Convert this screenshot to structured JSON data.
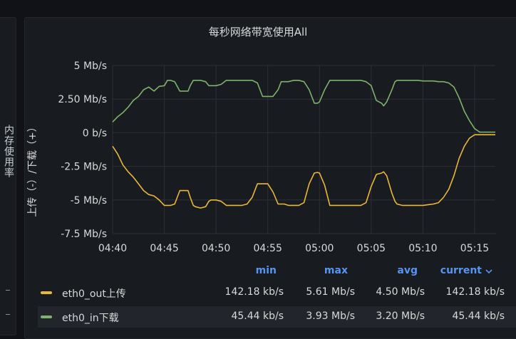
{
  "left_panel": {
    "vertical_text": "内存使用率"
  },
  "colors": {
    "in": "#7eb26d",
    "out": "#eab839",
    "grid": "#2c2f35",
    "axis_text": "#d8d9da",
    "legend_header": "#5794f2"
  },
  "legend": {
    "headers": [
      "min",
      "max",
      "avg",
      "current"
    ],
    "current_sort_icon": "chevron-down-icon",
    "rows": [
      {
        "name": "eth0_out上传",
        "color": "#eab839",
        "min": "142.18 kb/s",
        "max": "5.61 Mb/s",
        "avg": "4.50 Mb/s",
        "current": "142.18 kb/s"
      },
      {
        "name": "eth0_in下载",
        "color": "#7eb26d",
        "min": "45.44 kb/s",
        "max": "3.93 Mb/s",
        "avg": "3.20 Mb/s",
        "current": "45.44 kb/s"
      }
    ]
  },
  "chart_data": {
    "type": "line",
    "title": "每秒网络带宽使用All",
    "ylabel": "上传（-）/下载（+）",
    "xlabel": "",
    "ylim": [
      -7.5,
      5
    ],
    "yticks": [
      5,
      2.5,
      0,
      -2.5,
      -5,
      -7.5
    ],
    "ytick_labels": [
      "5 Mb/s",
      "2.50 Mb/s",
      "0 b/s",
      "-2.5 Mb/s",
      "-5 Mb/s",
      "-7.5 Mb/s"
    ],
    "xlim": [
      0,
      37
    ],
    "xticks": [
      0,
      5,
      10,
      15,
      20,
      25,
      30,
      35
    ],
    "xtick_labels": [
      "04:40",
      "04:45",
      "04:50",
      "04:55",
      "05:00",
      "05:05",
      "05:10",
      "05:15"
    ],
    "x_unit": "minutes after 04:40",
    "grid": true,
    "series": [
      {
        "name": "eth0_in下载",
        "color": "#7eb26d",
        "x": [
          0,
          0.5,
          1,
          1.5,
          2,
          2.5,
          3,
          3.5,
          4,
          4.5,
          5,
          5.3,
          5.6,
          6,
          6.5,
          7,
          7.3,
          7.5,
          7.8,
          8,
          8.5,
          9,
          9.3,
          9.5,
          9.8,
          10,
          10.5,
          11,
          11.5,
          12,
          12.5,
          13,
          13.5,
          14,
          14.5,
          15,
          15.5,
          16,
          16.3,
          16.6,
          17,
          17.5,
          18,
          18.5,
          19,
          19.5,
          19.8,
          20,
          20.5,
          21,
          21.5,
          22,
          22.5,
          23,
          23.5,
          24,
          24.5,
          25,
          25.5,
          26,
          26.2,
          26.5,
          27,
          27.3,
          27.5,
          28,
          28.5,
          29,
          29.5,
          30,
          30.5,
          31,
          31.5,
          32,
          32.5,
          33,
          33.5,
          34,
          34.5,
          35,
          35.5,
          36,
          36.5,
          37
        ],
        "y": [
          0.8,
          1.2,
          1.5,
          1.9,
          2.4,
          2.7,
          3.2,
          3.4,
          3.1,
          3.45,
          3.5,
          3.9,
          3.9,
          3.8,
          3.1,
          3.1,
          3.1,
          3.5,
          3.9,
          3.9,
          3.9,
          3.8,
          3.5,
          3.5,
          3.5,
          3.5,
          3.6,
          3.9,
          3.9,
          3.9,
          3.9,
          3.9,
          3.9,
          3.7,
          2.7,
          2.7,
          2.7,
          3.2,
          3.8,
          3.8,
          3.8,
          3.9,
          3.9,
          3.8,
          3.2,
          2.2,
          2.2,
          2.3,
          3.2,
          3.9,
          3.9,
          3.9,
          3.9,
          3.9,
          3.9,
          3.9,
          3.8,
          3.5,
          2.4,
          2.2,
          2.0,
          2.3,
          3.2,
          3.8,
          3.9,
          3.9,
          3.9,
          3.9,
          3.9,
          3.85,
          3.85,
          3.85,
          3.8,
          3.8,
          3.7,
          3.4,
          2.6,
          1.6,
          0.9,
          0.3,
          0.05,
          0.05,
          0.05,
          0.05
        ]
      },
      {
        "name": "eth0_out上传",
        "color": "#eab839",
        "x": [
          0,
          0.5,
          1,
          1.5,
          2,
          2.5,
          3,
          3.5,
          4,
          4.5,
          5,
          5.3,
          5.6,
          6,
          6.5,
          7,
          7.3,
          7.5,
          7.8,
          8,
          8.5,
          9,
          9.3,
          9.5,
          9.8,
          10,
          10.5,
          11,
          11.5,
          12,
          12.5,
          13,
          13.5,
          14,
          14.5,
          15,
          15.5,
          16,
          16.3,
          16.6,
          17,
          17.5,
          18,
          18.5,
          19,
          19.5,
          19.8,
          20,
          20.5,
          21,
          21.5,
          22,
          22.5,
          23,
          23.5,
          24,
          24.5,
          25,
          25.5,
          26,
          26.2,
          26.5,
          27,
          27.3,
          27.5,
          28,
          28.5,
          29,
          29.5,
          30,
          30.5,
          31,
          31.5,
          32,
          32.5,
          33,
          33.5,
          34,
          34.5,
          35,
          35.5,
          36,
          36.5,
          37
        ],
        "y": [
          -1.0,
          -1.6,
          -2.4,
          -2.9,
          -3.3,
          -3.8,
          -4.3,
          -4.6,
          -4.7,
          -5.0,
          -5.4,
          -5.4,
          -5.4,
          -5.3,
          -4.3,
          -4.3,
          -4.3,
          -4.8,
          -5.4,
          -5.5,
          -5.6,
          -5.5,
          -5.1,
          -5.0,
          -5.0,
          -5.0,
          -5.1,
          -5.4,
          -5.4,
          -5.4,
          -5.4,
          -5.3,
          -4.8,
          -3.8,
          -3.8,
          -3.8,
          -4.4,
          -5.3,
          -5.3,
          -5.3,
          -5.4,
          -5.4,
          -5.4,
          -5.2,
          -3.8,
          -3.0,
          -2.95,
          -3.0,
          -3.9,
          -5.4,
          -5.4,
          -5.4,
          -5.4,
          -5.4,
          -5.4,
          -5.4,
          -5.2,
          -4.0,
          -3.1,
          -3.0,
          -2.9,
          -3.2,
          -4.5,
          -5.1,
          -5.3,
          -5.4,
          -5.4,
          -5.4,
          -5.4,
          -5.4,
          -5.35,
          -5.3,
          -5.2,
          -4.8,
          -4.2,
          -3.2,
          -1.9,
          -1.0,
          -0.4,
          -0.15,
          -0.15,
          -0.15,
          -0.15,
          -0.15
        ]
      }
    ]
  }
}
